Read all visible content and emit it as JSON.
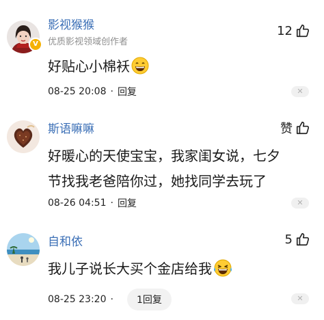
{
  "comments": [
    {
      "username": "影视猴猴",
      "subtitle": "优质影视领域创作者",
      "verified_badge": "V",
      "like_count": "12",
      "text": "好贴心小棉袄",
      "emoji": "grinning-face-emoji",
      "time": "08-25 20:08",
      "separator": "·",
      "reply": "回复"
    },
    {
      "username": "斯语嘛嘛",
      "like_count": "赞",
      "text_line1": "好暖心的天使宝宝，我家闺女说，七夕",
      "text_line2": "节找我老爸陪你过，她找同学去玩了",
      "time": "08-26 04:51",
      "separator": "·",
      "reply": "回复"
    },
    {
      "username": "自和依",
      "like_count": "5",
      "text": "我儿子说长大买个金店给我",
      "emoji": "tears-of-joy-emoji",
      "time": "08-25 23:20",
      "separator": "·",
      "reply": "1回复"
    }
  ],
  "icons": {
    "like": "thumbs-up-icon",
    "close": "close-icon"
  },
  "colors": {
    "username": "#3b6fb6",
    "subtitle": "#8f8f8f",
    "text": "#1a1a1a",
    "badge": "#f5b100"
  }
}
